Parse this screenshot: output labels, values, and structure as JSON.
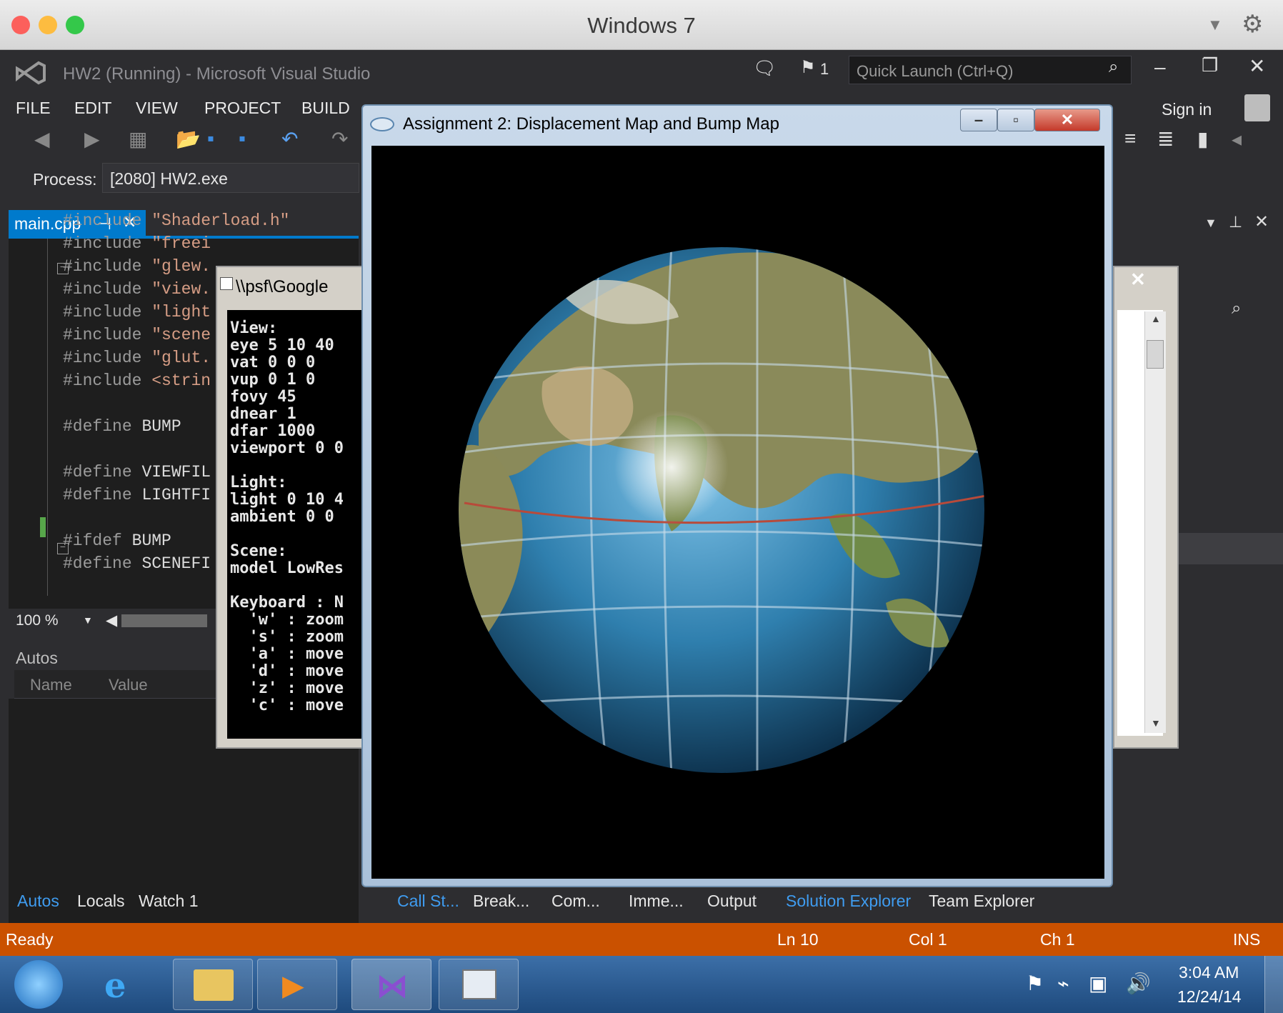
{
  "mac": {
    "title": "Windows 7"
  },
  "vs": {
    "title": "HW2 (Running) - Microsoft Visual Studio",
    "notifications": "1",
    "quick_launch_placeholder": "Quick Launch (Ctrl+Q)",
    "menu": [
      "FILE",
      "EDIT",
      "VIEW",
      "PROJECT",
      "BUILD"
    ],
    "sign_in": "Sign in",
    "process_label": "Process:",
    "process_value": "[2080] HW2.exe",
    "editor_tab": "main.cpp",
    "code_lines": [
      {
        "pre": "#include",
        "str": "\"Shaderload.h\""
      },
      {
        "pre": "#include",
        "str": "\"freei"
      },
      {
        "pre": "#include",
        "str": "\"glew."
      },
      {
        "pre": "#include",
        "str": "\"view."
      },
      {
        "pre": "#include",
        "str": "\"light"
      },
      {
        "pre": "#include",
        "str": "\"scene"
      },
      {
        "pre": "#include",
        "str": "\"glut."
      },
      {
        "pre": "#include",
        "str": "<strin"
      },
      {
        "pre": "#define",
        "str": "BUMP"
      },
      {
        "pre": "#define",
        "str": "VIEWFIL"
      },
      {
        "pre": "#define",
        "str": "LIGHTFI"
      },
      {
        "pre": "#ifdef",
        "str": "BUMP"
      },
      {
        "pre": "#define",
        "str": "SCENEFI"
      }
    ],
    "zoom": "100 %",
    "autos": {
      "title": "Autos",
      "col_name": "Name",
      "col_value": "Value"
    },
    "bottom_tabs_left": [
      "Autos",
      "Locals",
      "Watch 1"
    ],
    "bottom_tabs_right": [
      "Call St...",
      "Break...",
      "Com...",
      "Imme...",
      "Output",
      "Solution Explorer",
      "Team Explorer"
    ],
    "status": {
      "left": "Ready",
      "ln": "Ln 10",
      "col": "Col 1",
      "ch": "Ch 1",
      "mode": "INS"
    }
  },
  "console": {
    "title": "\\\\psf\\Google",
    "lines": [
      "View:",
      "eye 5 10 40",
      "vat 0 0 0",
      "vup 0 1 0",
      "fovy 45",
      "dnear 1",
      "dfar 1000",
      "viewport 0 0",
      "",
      "Light:",
      "light 0 10 4",
      "ambient 0 0",
      "",
      "Scene:",
      "model LowRes",
      "",
      "Keyboard : N",
      "  'w' : zoom",
      "  's' : zoom",
      "  'a' : move",
      "  'd' : move",
      "  'z' : move",
      "  'c' : move"
    ]
  },
  "glut": {
    "title": "Assignment 2: Displacement Map and Bump Map"
  },
  "taskbar": {
    "time": "3:04 AM",
    "date": "12/24/14"
  },
  "colors": {
    "accent": "#007acc",
    "status_bar": "#ca5100",
    "vs_bg": "#2d2d30",
    "editor_bg": "#1e1e1e"
  }
}
